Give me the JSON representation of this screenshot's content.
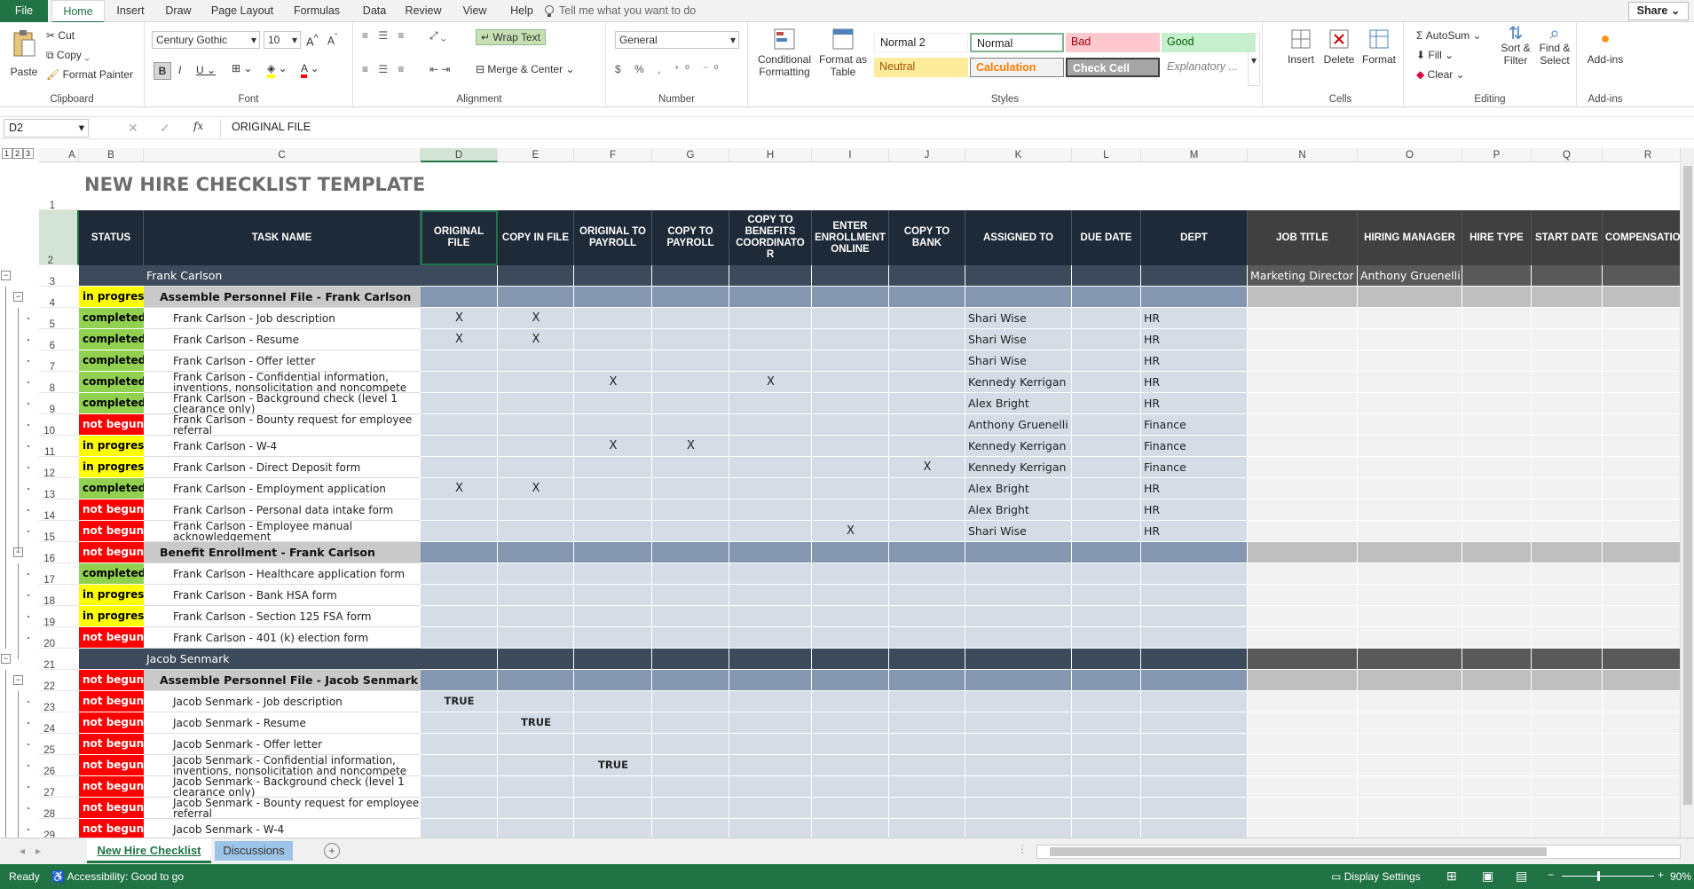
{
  "ribbon_tabs": [
    "File",
    "Home",
    "Insert",
    "Draw",
    "Page Layout",
    "Formulas",
    "Data",
    "Review",
    "View",
    "Help"
  ],
  "tell_me": "Tell me what you want to do",
  "share": "Share",
  "clipboard": {
    "paste": "Paste",
    "cut": "Cut",
    "copy": "Copy",
    "format_painter": "Format Painter",
    "label": "Clipboard"
  },
  "font": {
    "name": "Century Gothic",
    "size": "10",
    "label": "Font"
  },
  "alignment": {
    "wrap": "Wrap Text",
    "merge": "Merge & Center",
    "label": "Alignment"
  },
  "number": {
    "format": "General",
    "label": "Number"
  },
  "styles": {
    "conditional": "Conditional Formatting",
    "format_table": "Format as Table",
    "normal2": "Normal 2",
    "normal": "Normal",
    "bad": "Bad",
    "good": "Good",
    "neutral": "Neutral",
    "calculation": "Calculation",
    "check_cell": "Check Cell",
    "explanatory": "Explanatory ...",
    "label": "Styles"
  },
  "cells": {
    "insert": "Insert",
    "delete": "Delete",
    "format": "Format",
    "label": "Cells"
  },
  "editing": {
    "autosum": "AutoSum",
    "fill": "Fill",
    "clear": "Clear",
    "sort": "Sort & Filter",
    "find": "Find & Select",
    "label": "Editing"
  },
  "addins": {
    "addins": "Add-ins",
    "label": "Add-ins"
  },
  "name_box": "D2",
  "formula": "ORIGINAL FILE",
  "outline_levels": [
    "1",
    "2",
    "3"
  ],
  "columns": [
    "A",
    "B",
    "C",
    "D",
    "E",
    "F",
    "G",
    "H",
    "I",
    "J",
    "K",
    "L",
    "M",
    "N",
    "O",
    "P",
    "Q",
    "R"
  ],
  "title": "NEW HIRE CHECKLIST TEMPLATE",
  "headers": [
    "STATUS",
    "TASK NAME",
    "ORIGINAL FILE",
    "COPY IN FILE",
    "ORIGINAL TO PAYROLL",
    "COPY TO PAYROLL",
    "COPY TO BENEFITS COORDINATO R",
    "ENTER ENROLLMENT ONLINE",
    "COPY TO BANK",
    "ASSIGNED TO",
    "DUE DATE",
    "DEPT",
    "JOB TITLE",
    "HIRING MANAGER",
    "HIRE TYPE",
    "START DATE",
    "COMPENSATIO N"
  ],
  "row_numbers": [
    "1",
    "2",
    "3",
    "4",
    "5",
    "6",
    "7",
    "8",
    "9",
    "10",
    "11",
    "12",
    "13",
    "14",
    "15",
    "16",
    "17",
    "18",
    "19",
    "20",
    "21",
    "22",
    "23",
    "24",
    "25",
    "26",
    "27",
    "28",
    "29"
  ],
  "rows": [
    {
      "kind": "person",
      "task": "Frank Carlson",
      "job": "Marketing Director",
      "mgr": "Anthony Gruenelli"
    },
    {
      "kind": "section",
      "status": "in progress",
      "st": "p",
      "task": "Assemble Personnel File - Frank Carlson"
    },
    {
      "kind": "task",
      "status": "completed",
      "st": "c",
      "task": "Frank Carlson - Job description",
      "marks": {
        "D": "X",
        "E": "X"
      },
      "assigned": "Shari Wise",
      "dept": "HR"
    },
    {
      "kind": "task",
      "status": "completed",
      "st": "c",
      "task": "Frank Carlson - Resume",
      "marks": {
        "D": "X",
        "E": "X"
      },
      "assigned": "Shari Wise",
      "dept": "HR"
    },
    {
      "kind": "task",
      "status": "completed",
      "st": "c",
      "task": "Frank Carlson - Offer letter",
      "marks": {},
      "assigned": "Shari Wise",
      "dept": "HR"
    },
    {
      "kind": "task",
      "status": "completed",
      "st": "c",
      "task": "Frank Carlson - Confidential information, inventions, nonsolicitation and noncompete",
      "marks": {
        "F": "X",
        "H": "X"
      },
      "assigned": "Kennedy Kerrigan",
      "dept": "HR"
    },
    {
      "kind": "task",
      "status": "completed",
      "st": "c",
      "task": "Frank Carlson - Background check (level 1 clearance only)",
      "marks": {},
      "assigned": "Alex Bright",
      "dept": "HR"
    },
    {
      "kind": "task",
      "status": "not begun",
      "st": "n",
      "task": "Frank Carlson - Bounty request for employee referral",
      "marks": {},
      "assigned": "Anthony Gruenelli",
      "dept": "Finance"
    },
    {
      "kind": "task",
      "status": "in progress",
      "st": "p",
      "task": "Frank Carlson - W-4",
      "marks": {
        "F": "X",
        "G": "X"
      },
      "assigned": "Kennedy Kerrigan",
      "dept": "Finance"
    },
    {
      "kind": "task",
      "status": "in progress",
      "st": "p",
      "task": "Frank Carlson - Direct Deposit form",
      "marks": {
        "J": "X"
      },
      "assigned": "Kennedy Kerrigan",
      "dept": "Finance"
    },
    {
      "kind": "task",
      "status": "completed",
      "st": "c",
      "task": "Frank Carlson - Employment application",
      "marks": {
        "D": "X",
        "E": "X"
      },
      "assigned": "Alex Bright",
      "dept": "HR"
    },
    {
      "kind": "task",
      "status": "not begun",
      "st": "n",
      "task": "Frank Carlson - Personal data intake form",
      "marks": {},
      "assigned": "Alex Bright",
      "dept": "HR"
    },
    {
      "kind": "task",
      "status": "not begun",
      "st": "n",
      "task": "Frank Carlson - Employee manual acknowledgement",
      "marks": {
        "I": "X"
      },
      "assigned": "Shari Wise",
      "dept": "HR"
    },
    {
      "kind": "section",
      "status": "not begun",
      "st": "n",
      "task": "Benefit Enrollment - Frank Carlson"
    },
    {
      "kind": "task",
      "status": "completed",
      "st": "c",
      "task": "Frank Carlson - Healthcare application form",
      "marks": {},
      "assigned": "",
      "dept": ""
    },
    {
      "kind": "task",
      "status": "in progress",
      "st": "p",
      "task": "Frank Carlson - Bank HSA form",
      "marks": {},
      "assigned": "",
      "dept": ""
    },
    {
      "kind": "task",
      "status": "in progress",
      "st": "p",
      "task": "Frank Carlson - Section 125 FSA form",
      "marks": {},
      "assigned": "",
      "dept": ""
    },
    {
      "kind": "task",
      "status": "not begun",
      "st": "n",
      "task": "Frank Carlson - 401 (k) election form",
      "marks": {},
      "assigned": "",
      "dept": ""
    },
    {
      "kind": "person",
      "task": "Jacob Senmark",
      "job": "",
      "mgr": ""
    },
    {
      "kind": "section",
      "status": "not begun",
      "st": "n",
      "task": "Assemble Personnel File - Jacob Senmark"
    },
    {
      "kind": "task",
      "status": "not begun",
      "st": "n",
      "task": "Jacob Senmark - Job description",
      "marks": {
        "D": "TRUE"
      },
      "assigned": "",
      "dept": ""
    },
    {
      "kind": "task",
      "status": "not begun",
      "st": "n",
      "task": "Jacob Senmark - Resume",
      "marks": {
        "E": "TRUE"
      },
      "assigned": "",
      "dept": ""
    },
    {
      "kind": "task",
      "status": "not begun",
      "st": "n",
      "task": "Jacob Senmark - Offer letter",
      "marks": {},
      "assigned": "",
      "dept": ""
    },
    {
      "kind": "task",
      "status": "not begun",
      "st": "n",
      "task": "Jacob Senmark - Confidential information, inventions, nonsolicitation and noncompete",
      "marks": {
        "F": "TRUE"
      },
      "assigned": "",
      "dept": ""
    },
    {
      "kind": "task",
      "status": "not begun",
      "st": "n",
      "task": "Jacob Senmark - Background check (level 1 clearance only)",
      "marks": {},
      "assigned": "",
      "dept": ""
    },
    {
      "kind": "task",
      "status": "not begun",
      "st": "n",
      "task": "Jacob Senmark - Bounty request for employee referral",
      "marks": {},
      "assigned": "",
      "dept": ""
    },
    {
      "kind": "task",
      "status": "not begun",
      "st": "n",
      "task": "Jacob Senmark - W-4",
      "marks": {},
      "assigned": "",
      "dept": ""
    }
  ],
  "sheets": [
    "New Hire Checklist",
    "Discussions"
  ],
  "status_bar": {
    "ready": "Ready",
    "accessibility": "Accessibility: Good to go",
    "display": "Display Settings",
    "zoom": "90%"
  },
  "colors": {
    "accent": "#217346",
    "header_dark": "#1f2a38",
    "completed": "#92d050",
    "in_progress": "#ffff00",
    "not_begun": "#ff0000"
  }
}
